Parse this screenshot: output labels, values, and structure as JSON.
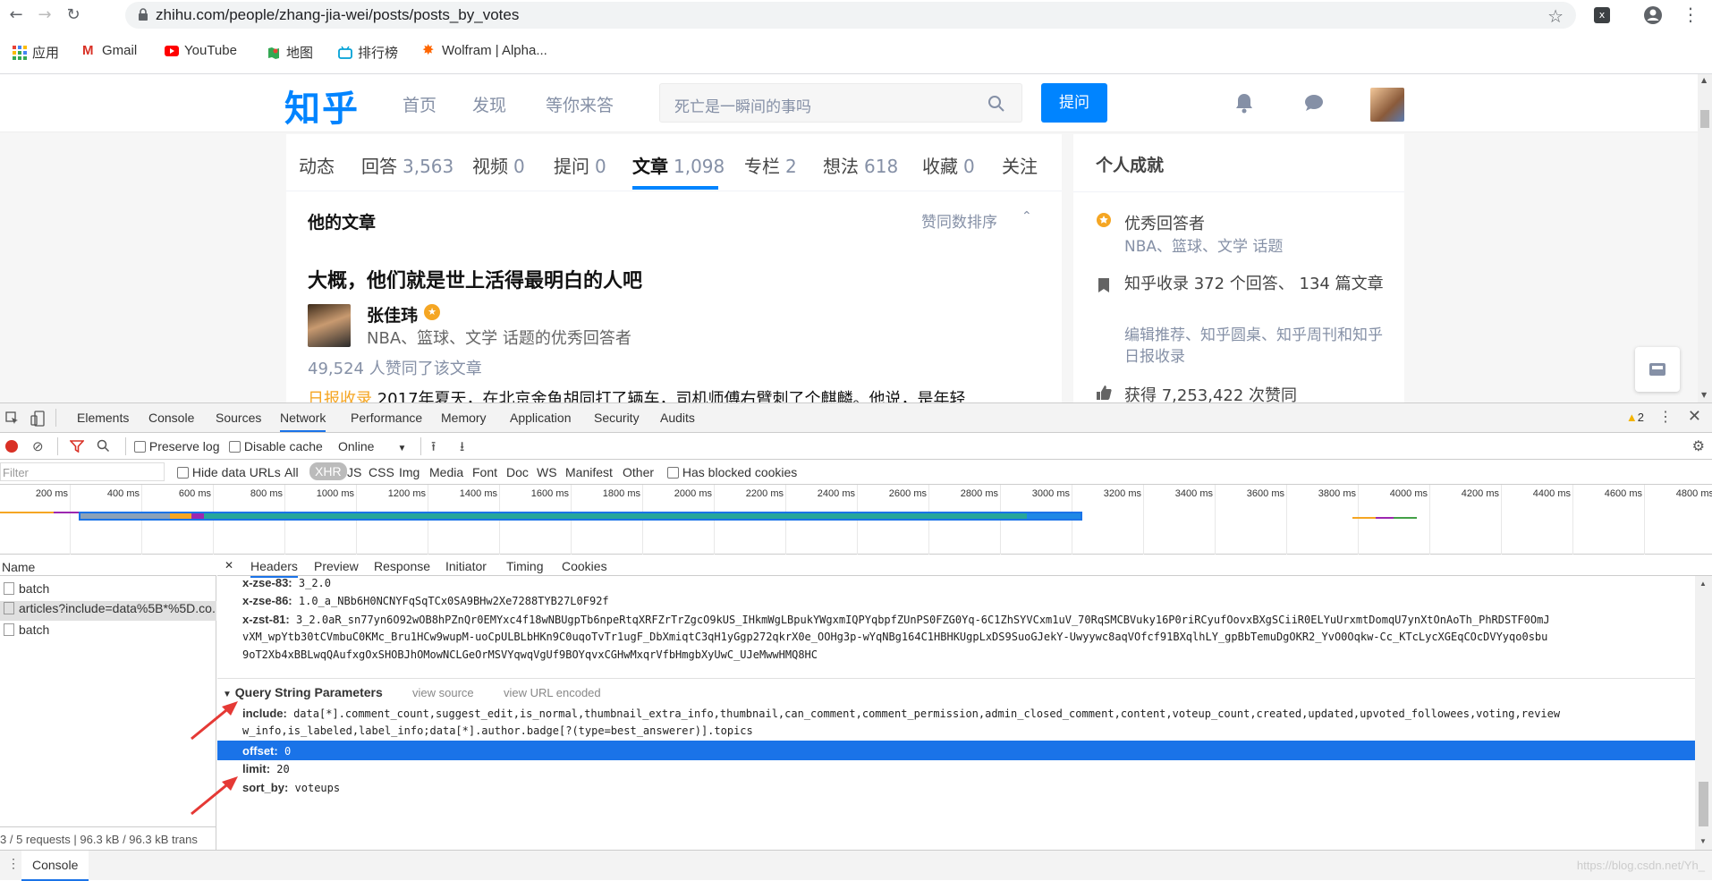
{
  "browser": {
    "url": "zhihu.com/people/zhang-jia-wei/posts/posts_by_votes",
    "bookmarks": [
      "应用",
      "Gmail",
      "YouTube",
      "地图",
      "排行榜",
      "Wolfram | Alpha..."
    ]
  },
  "zhihu": {
    "logo": "知乎",
    "nav": [
      "首页",
      "发现",
      "等你来答"
    ],
    "search_placeholder": "死亡是一瞬间的事吗",
    "ask_button": "提问",
    "tabs": [
      {
        "label": "动态",
        "count": ""
      },
      {
        "label": "回答",
        "count": "3,563"
      },
      {
        "label": "视频",
        "count": "0"
      },
      {
        "label": "提问",
        "count": "0"
      },
      {
        "label": "文章",
        "count": "1,098"
      },
      {
        "label": "专栏",
        "count": "2"
      },
      {
        "label": "想法",
        "count": "618"
      },
      {
        "label": "收藏",
        "count": "0"
      },
      {
        "label": "关注",
        "count": ""
      }
    ],
    "section_title": "他的文章",
    "sort_label": "赞同数排序",
    "article": {
      "title": "大概，他们就是世上活得最明白的人吧",
      "author": "张佳玮",
      "author_desc": "NBA、篮球、文学 话题的优秀回答者",
      "votes": "49,524 人赞同了该文章",
      "excerpt_tag": "日报收录",
      "excerpt": "2017年夏天，在北京金鱼胡同打了辆车，司机师傅右臂刺了个麒麟。他说，是年轻"
    },
    "achievements": {
      "title": "个人成就",
      "items": [
        {
          "text": "优秀回答者",
          "sub": "NBA、篮球、文学 话题"
        },
        {
          "text": "知乎收录 372 个回答、 134 篇文章",
          "sub": "编辑推荐、知乎圆桌、知乎周刊和知乎日报收录"
        },
        {
          "text": "获得 7,253,422 次赞同",
          "sub": ""
        }
      ]
    }
  },
  "devtools": {
    "tabs": [
      "Elements",
      "Console",
      "Sources",
      "Network",
      "Performance",
      "Memory",
      "Application",
      "Security",
      "Audits"
    ],
    "active_tab": "Network",
    "warning_count": "2",
    "toolbar": {
      "preserve_log": "Preserve log",
      "disable_cache": "Disable cache",
      "throttle": "Online"
    },
    "filter": {
      "placeholder": "Filter",
      "hide_data_urls": "Hide data URLs",
      "types": [
        "All",
        "XHR",
        "JS",
        "CSS",
        "Img",
        "Media",
        "Font",
        "Doc",
        "WS",
        "Manifest",
        "Other"
      ],
      "active_type": "XHR",
      "blocked": "Has blocked cookies"
    },
    "timeline_ticks": [
      "200 ms",
      "400 ms",
      "600 ms",
      "800 ms",
      "1000 ms",
      "1200 ms",
      "1400 ms",
      "1600 ms",
      "1800 ms",
      "2000 ms",
      "2200 ms",
      "2400 ms",
      "2600 ms",
      "2800 ms",
      "3000 ms",
      "3200 ms",
      "3400 ms",
      "3600 ms",
      "3800 ms",
      "4000 ms",
      "4200 ms",
      "4400 ms",
      "4600 ms",
      "4800 ms"
    ],
    "name_header": "Name",
    "requests": [
      "batch",
      "articles?include=data%5B*%5D.co...",
      "batch"
    ],
    "status": "3 / 5 requests | 96.3 kB / 96.3 kB trans",
    "sub_tabs": [
      "Headers",
      "Preview",
      "Response",
      "Initiator",
      "Timing",
      "Cookies"
    ],
    "active_sub_tab": "Headers",
    "headers": [
      {
        "key": "x-zse-83:",
        "value": "3_2.0"
      },
      {
        "key": "x-zse-86:",
        "value": "1.0_a_NBb6H0NCNYFqSqTCx0SA9BHw2Xe7288TYB27L0F92f"
      },
      {
        "key": "x-zst-81:",
        "value": "3_2.0aR_sn77yn6O92wOB8hPZnQr0EMYxc4f18wNBUgpTb6npeRtqXRFZrTrZgcO9kUS_IHkmWgLBpukYWgxmIQPYqbpfZUnPS0FZG0Yq-6C1ZhSYVCxm1uV_70RqSMCBVuky16P0riRCyufOovxBXgSCiiR0ELYuUrxmtDomqU7ynXtOnAoTh_PhRDSTF0OmJ"
      },
      {
        "key": "",
        "value": "vXM_wpYtb30tCVmbuC0KMc_Bru1HCw9wupM-uoCpULBLbHKn9C0uqoTvTr1ugF_DbXmiqtC3qH1yGgp272qkrX0e_OOHg3p-wYqNBg164C1HBHKUgpLxDS9SuoGJekY-Uwyywc8aqVOfcf91BXqlhLY_gpBbTemuDgOKR2_YvO0Oqkw-Cc_KTcLycXGEqCOcDVYyqo0sbu"
      },
      {
        "key": "",
        "value": "9oT2Xb4xBBLwqQAufxgOxSHOBJhOMowNCLGeOrMSVYqwqVgUf9BOYqvxCGHwMxqrVfbHmgbXyUwC_UJeMwwHMQ8HC"
      }
    ],
    "qsp": {
      "title": "Query String Parameters",
      "view_source": "view source",
      "view_url_encoded": "view URL encoded",
      "params": [
        {
          "key": "include:",
          "value": "data[*].comment_count,suggest_edit,is_normal,thumbnail_extra_info,thumbnail,can_comment,comment_permission,admin_closed_comment,content,voteup_count,created,updated,upvoted_followees,voting,review"
        },
        {
          "key": "",
          "value": "w_info,is_labeled,label_info;data[*].author.badge[?(type=best_answerer)].topics"
        },
        {
          "key": "offset:",
          "value": "0"
        },
        {
          "key": "limit:",
          "value": "20"
        },
        {
          "key": "sort_by:",
          "value": "voteups"
        }
      ]
    },
    "drawer_tab": "Console",
    "watermark": "https://blog.csdn.net/Yh_"
  },
  "colors": {
    "zhihu_blue": "#0084ff",
    "devtools_selection": "#1a73e8",
    "annotation_red": "#e53935"
  }
}
